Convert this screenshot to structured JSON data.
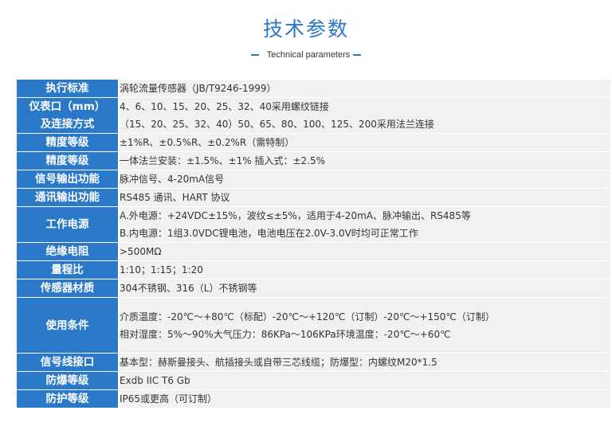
{
  "header": {
    "title": "技术参数",
    "subtitle": "Technical parameters"
  },
  "rows": [
    {
      "label": [
        "执行标准"
      ],
      "value": [
        "涡轮流量传感器（JB/T9246-1999）"
      ]
    },
    {
      "label": [
        "仪表口（mm）",
        "及连接方式"
      ],
      "value": [
        " 4、6、10、15、20、25、32、40采用螺纹链接",
        "（15、20、25、32、40）50、65、80、100、125、200采用法兰连接"
      ]
    },
    {
      "label": [
        "精度等级"
      ],
      "value": [
        "±1%R、±0.5%R、±0.2%R（需特制）"
      ]
    },
    {
      "label": [
        "精度等级"
      ],
      "value": [
        "一体法兰安装：±1.5%、±1%    插入式：±2.5%"
      ]
    },
    {
      "label": [
        "信号输出功能"
      ],
      "value": [
        "脉冲信号、4-20mA信号"
      ]
    },
    {
      "label": [
        "通讯输出功能"
      ],
      "value": [
        "RS485 通讯、HART 协议"
      ]
    },
    {
      "label": [
        "工作电源"
      ],
      "value": [
        "A.外电源：+24VDC±15%，波纹≤±5%，适用于4-20mA、脉冲输出、RS485等",
        "B.内电源：1组3.0VDC锂电池，电池电压在2.0V-3.0V时均可正常工作"
      ]
    },
    {
      "label": [
        "绝缘电阻"
      ],
      "value": [
        ">500MΩ"
      ]
    },
    {
      "label": [
        "量程比"
      ],
      "value": [
        "1:10；1:15；1:20"
      ]
    },
    {
      "label": [
        "传感器材质"
      ],
      "value": [
        " 304不锈钢、316（L）不锈钢等"
      ]
    },
    {
      "label": [
        "使用条件"
      ],
      "value": [
        "介质温度：-20℃～+80℃（标配）-20℃～+120℃（订制）-20℃～+150℃（订制）",
        "相对湿度：5%～90%大气压力：86KPa～106KPa环境温度：-20℃～+60℃"
      ]
    },
    {
      "label": [
        "信号线接口"
      ],
      "value": [
        "基本型：赫斯曼接头、航插接头或自带三芯线缆；防爆型：内螺纹M20*1.5"
      ]
    },
    {
      "label": [
        "防爆等级"
      ],
      "value": [
        "Exdb IIC T6 Gb"
      ]
    },
    {
      "label": [
        "防护等级"
      ],
      "value": [
        "IP65或更高（可订制）"
      ]
    }
  ],
  "colors": {
    "accent": "#2a78c8",
    "value_bg": "#f1f1f1",
    "text": "#333333"
  }
}
